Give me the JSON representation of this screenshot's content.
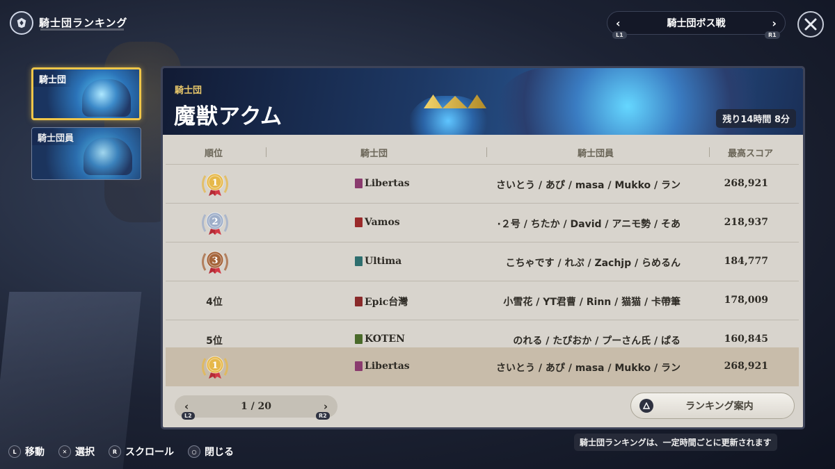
{
  "header": {
    "title": "騎士団ランキング",
    "mode_label": "騎士団ボス戦",
    "prev_tag": "L1",
    "next_tag": "R1"
  },
  "tabs": [
    {
      "label": "騎士団"
    },
    {
      "label": "騎士団員"
    }
  ],
  "banner": {
    "subtitle": "騎士団",
    "boss_name": "魔獣アクム",
    "time_left": "残り14時間 8分"
  },
  "columns": {
    "rank": "順位",
    "guild": "騎士団",
    "members": "騎士団員",
    "score": "最高スコア"
  },
  "rows": [
    {
      "rank": "1",
      "medal": "gold",
      "guild": "Libertas",
      "flag_color": "#8a3b6e",
      "members": "さいとう / あぴ / masa / Mukko / ラン",
      "score": "268,921"
    },
    {
      "rank": "2",
      "medal": "silver",
      "guild": "Vamos",
      "flag_color": "#9a2a2a",
      "members": "·２号 / ちたか / David / アニモ勢 / そあ",
      "score": "218,937"
    },
    {
      "rank": "3",
      "medal": "bronze",
      "guild": "Ultima",
      "flag_color": "#2e6e6e",
      "members": "こちゃです / れぷ / Zachjp / らめるん",
      "score": "184,777"
    },
    {
      "rank_label": "4位",
      "guild": "Epic台灣",
      "flag_color": "#8a2a2a",
      "members": "小雪花 / YT君曹 / Rinn / 猫猫 / 卡帶筆",
      "score": "178,009"
    },
    {
      "rank_label": "5位",
      "guild": "KOTEN",
      "flag_color": "#4a6a2a",
      "members": "のれる / たぴおか / プーさん氏 / ぱる",
      "score": "160,845"
    }
  ],
  "my_row": {
    "rank": "1",
    "medal": "gold",
    "guild": "Libertas",
    "flag_color": "#8a3b6e",
    "members": "さいとう / あぴ / masa / Mukko / ラン",
    "score": "268,921"
  },
  "pager": {
    "text": "1 / 20",
    "prev_tag": "L2",
    "next_tag": "R2"
  },
  "guide_button": {
    "label": "ランキング案内"
  },
  "footer": {
    "items": [
      {
        "btn": "L",
        "label": "移動"
      },
      {
        "btn": "✕",
        "label": "選択"
      },
      {
        "btn": "R",
        "label": "スクロール"
      },
      {
        "btn": "○",
        "label": "閉じる"
      }
    ],
    "notice": "騎士団ランキングは、一定時間ごとに更新されます"
  },
  "colors": {
    "gold": "#e6b84a",
    "silver": "#9eaec9",
    "bronze": "#a5643a",
    "accent": "#f0c649"
  },
  "icons": {
    "close": "close-icon",
    "triangle": "triangle-icon"
  }
}
